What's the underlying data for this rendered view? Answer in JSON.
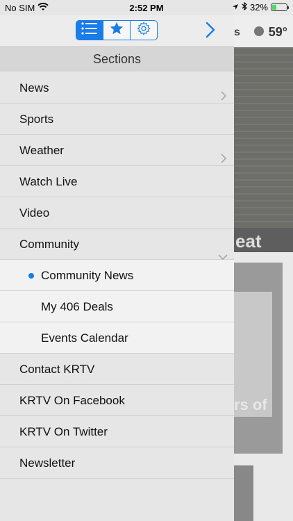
{
  "status": {
    "carrier": "No SIM",
    "time": "2:52 PM",
    "battery": "32%",
    "battery_level": 0.32
  },
  "background": {
    "temperature": "59°",
    "partial_title_1": "eat",
    "partial_title_2": "rs of",
    "partial_letter": "s"
  },
  "toolbar": {
    "tabs": [
      "sections-list",
      "favorites-star",
      "settings-gear"
    ],
    "active_tab": "sections-list"
  },
  "sections": {
    "title": "Sections",
    "items": [
      {
        "label": "News",
        "chevron": "right"
      },
      {
        "label": "Sports"
      },
      {
        "label": "Weather",
        "chevron": "right"
      },
      {
        "label": "Watch Live"
      },
      {
        "label": "Video"
      },
      {
        "label": "Community",
        "chevron": "down"
      },
      {
        "label": "Community News",
        "sub": true,
        "selected": true
      },
      {
        "label": "My 406 Deals",
        "sub": true
      },
      {
        "label": "Events Calendar",
        "sub": true
      },
      {
        "label": "Contact KRTV"
      },
      {
        "label": "KRTV On Facebook"
      },
      {
        "label": "KRTV On Twitter"
      },
      {
        "label": "Newsletter"
      }
    ]
  },
  "colors": {
    "accent": "#1a7ce8",
    "battery_fill": "#4cd964"
  }
}
